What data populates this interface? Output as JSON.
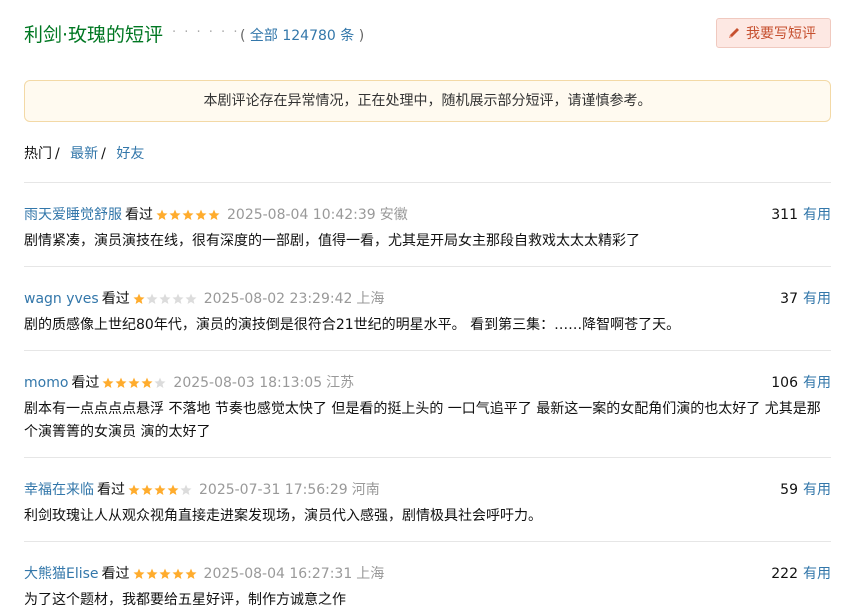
{
  "header": {
    "title": "利剑·玫瑰的短评",
    "dots": "· · · · · ·",
    "count_open": "(",
    "count_link": "全部 124780 条",
    "count_close": ")",
    "write_button": "我要写短评"
  },
  "notice": "本剧评论存在异常情况，正在处理中，随机展示部分短评，请谨慎参考。",
  "tabs": {
    "hot": "热门",
    "latest": "最新",
    "friends": "好友",
    "separator": "/"
  },
  "colors": {
    "star_on": "#ffac2d",
    "star_off": "#dcdcdc",
    "link": "#3377aa",
    "title": "#007722"
  },
  "comments": [
    {
      "author": "雨天爱睡觉舒服",
      "status": "看过",
      "rating": 5,
      "time": "2025-08-04 10:42:39",
      "location": "安徽",
      "votes": "311",
      "vote_label": "有用",
      "text": "剧情紧凑，演员演技在线，很有深度的一部剧，值得一看，尤其是开局女主那段自救戏太太太精彩了"
    },
    {
      "author": "wagn yves",
      "status": "看过",
      "rating": 1,
      "time": "2025-08-02 23:29:42",
      "location": "上海",
      "votes": "37",
      "vote_label": "有用",
      "text": "剧的质感像上世纪80年代，演员的演技倒是很符合21世纪的明星水平。 看到第三集：……降智啊苍了天。"
    },
    {
      "author": "momo",
      "status": "看过",
      "rating": 4,
      "time": "2025-08-03 18:13:05",
      "location": "江苏",
      "votes": "106",
      "vote_label": "有用",
      "text": "剧本有一点点点点悬浮 不落地 节奏也感觉太快了 但是看的挺上头的 一口气追平了 最新这一案的女配角们演的也太好了 尤其是那个演箐箐的女演员 演的太好了"
    },
    {
      "author": "幸福在来临",
      "status": "看过",
      "rating": 4,
      "time": "2025-07-31 17:56:29",
      "location": "河南",
      "votes": "59",
      "vote_label": "有用",
      "text": "利剑玫瑰让人从观众视角直接走进案发现场，演员代入感强，剧情极具社会呼吁力。"
    },
    {
      "author": "大熊猫Elise",
      "status": "看过",
      "rating": 5,
      "time": "2025-08-04 16:27:31",
      "location": "上海",
      "votes": "222",
      "vote_label": "有用",
      "text": "为了这个题材，我都要给五星好评，制作方诚意之作"
    }
  ]
}
